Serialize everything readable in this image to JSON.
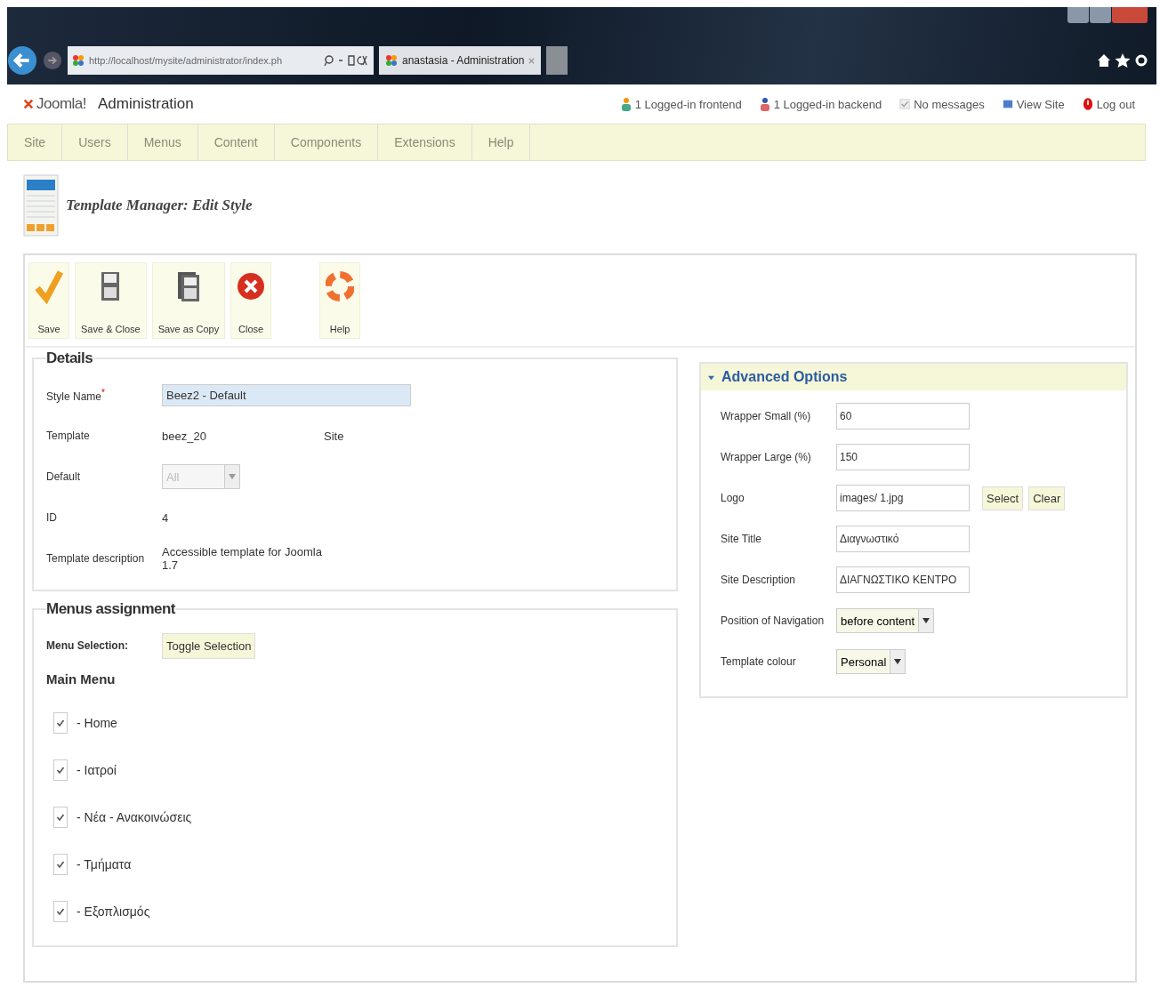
{
  "browser": {
    "address": "http://localhost/mysite/administrator/index.ph",
    "tab_title": "anastasia - Administration"
  },
  "header": {
    "brand": "Joomla!",
    "title": "Administration",
    "status": [
      {
        "kind": "frontend",
        "text": "1 Logged-in frontend"
      },
      {
        "kind": "backend",
        "text": "1 Logged-in backend"
      },
      {
        "kind": "messages",
        "text": "No messages"
      },
      {
        "kind": "view",
        "text": "View Site"
      },
      {
        "kind": "logout",
        "text": "Log out"
      }
    ]
  },
  "menu": [
    {
      "label": "Site",
      "disabled": true
    },
    {
      "label": "Users",
      "disabled": true
    },
    {
      "label": "Menus",
      "disabled": true
    },
    {
      "label": "Content",
      "disabled": true
    },
    {
      "label": "Components",
      "disabled": true
    },
    {
      "label": "Extensions",
      "disabled": true
    },
    {
      "label": "Help",
      "disabled": true
    }
  ],
  "page_title": "Template Manager: Edit Style",
  "toolbar": [
    {
      "kind": "save",
      "label": "Save"
    },
    {
      "kind": "save-close",
      "label": "Save & Close"
    },
    {
      "kind": "save-copy",
      "label": "Save as Copy"
    },
    {
      "kind": "close",
      "label": "Close"
    },
    {
      "kind": "help",
      "label": "Help"
    }
  ],
  "details": {
    "legend": "Details",
    "rows": [
      {
        "kind": "input",
        "label": "Style Name",
        "required_mark": "*",
        "value": "Beez2 - Default"
      },
      {
        "kind": "text",
        "label": "Template",
        "value": "beez_20",
        "extra": "Site"
      },
      {
        "kind": "select",
        "label": "Default",
        "value": "All",
        "disabled": true
      },
      {
        "kind": "text",
        "label": "ID",
        "value": "4"
      },
      {
        "kind": "text",
        "label": "Template description",
        "value": "Accessible template for Joomla 1.7"
      }
    ]
  },
  "menus_assignment": {
    "legend": "Menus assignment",
    "selection_label": "Menu Selection:",
    "toggle_button": "Toggle Selection",
    "menu_title": "Main Menu",
    "items": [
      {
        "label": "- Home",
        "checked": true
      },
      {
        "label": "- Ιατροί",
        "checked": true
      },
      {
        "label": "- Νέα - Ανακοινώσεις",
        "checked": true
      },
      {
        "label": "- Τμήματα",
        "checked": true
      },
      {
        "label": "- Εξοπλισμός",
        "checked": true
      }
    ]
  },
  "advanced_options": {
    "title": "Advanced Options",
    "expanded": true,
    "rows": [
      {
        "kind": "input",
        "label": "Wrapper Small (%)",
        "value": "60"
      },
      {
        "kind": "input",
        "label": "Wrapper Large (%)",
        "value": "150"
      },
      {
        "kind": "media",
        "label": "Logo",
        "value": "images/ 1.jpg",
        "buttons": [
          "Select",
          "Clear"
        ]
      },
      {
        "kind": "input",
        "label": "Site Title",
        "value": "Διαγνωστικό"
      },
      {
        "kind": "input",
        "label": "Site Description",
        "value": "ΔΙΑΓΝΩΣΤΙΚΟ ΚΕΝΤΡΟ"
      },
      {
        "kind": "select",
        "label": "Position of Navigation",
        "value": "before content"
      },
      {
        "kind": "select",
        "label": "Template colour",
        "value": "Personal"
      }
    ]
  }
}
